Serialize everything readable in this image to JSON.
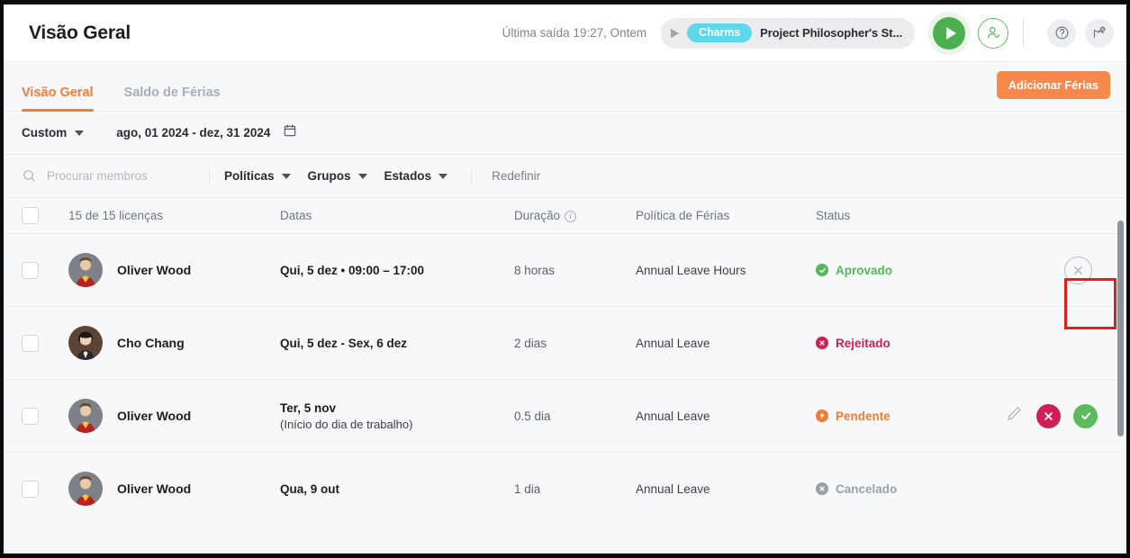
{
  "header": {
    "title": "Visão Geral",
    "last_out": "Última saída 19:27, Ontem",
    "timer_tag": "Charms",
    "timer_project": "Project Philosopher's St...",
    "play_icon": "play-icon",
    "user_icon": "user-check-icon",
    "help_icon": "question-mark-icon",
    "settings_icon": "settings-gear-icon"
  },
  "tabs": {
    "items": [
      {
        "label": "Visão Geral",
        "active": true
      },
      {
        "label": "Saldo de Férias",
        "active": false
      }
    ],
    "add_button": "Adicionar Férias"
  },
  "daterange": {
    "preset": "Custom",
    "range": "ago, 01 2024 - dez, 31 2024",
    "calendar_icon": "calendar-icon"
  },
  "filters": {
    "search_placeholder": "Procurar membros",
    "search_value": "",
    "search_icon": "search-icon",
    "dropdowns": [
      "Políticas",
      "Grupos",
      "Estados"
    ],
    "reset": "Redefinir"
  },
  "table": {
    "headers": {
      "licenses": "15 de 15 licenças",
      "dates": "Datas",
      "duration": "Duração",
      "duration_info_icon": "info-icon",
      "policy": "Política de Férias",
      "status": "Status"
    },
    "rows": [
      {
        "name": "Oliver Wood",
        "avatar": "oliver-wood-avatar",
        "dates": "Qui, 5 dez • 09:00 – 17:00",
        "dates_sub": "",
        "duration": "8 horas",
        "policy": "Annual Leave Hours",
        "status": "Aprovado",
        "status_kind": "approved",
        "actions": [
          "cancel-circle"
        ]
      },
      {
        "name": "Cho Chang",
        "avatar": "cho-chang-avatar",
        "dates": "Qui, 5 dez - Sex, 6 dez",
        "dates_sub": "",
        "duration": "2 dias",
        "policy": "Annual Leave",
        "status": "Rejeitado",
        "status_kind": "rejected",
        "actions": []
      },
      {
        "name": "Oliver Wood",
        "avatar": "oliver-wood-avatar",
        "dates": "Ter, 5 nov",
        "dates_sub": "(Início do dia de trabalho)",
        "duration": "0.5 dia",
        "policy": "Annual Leave",
        "status": "Pendente",
        "status_kind": "pending",
        "actions": [
          "edit",
          "reject",
          "approve"
        ]
      },
      {
        "name": "Oliver Wood",
        "avatar": "oliver-wood-avatar",
        "dates": "Qua, 9 out",
        "dates_sub": "",
        "duration": "1 dia",
        "policy": "Annual Leave",
        "status": "Cancelado",
        "status_kind": "cancel",
        "actions": []
      }
    ]
  },
  "colors": {
    "accent": "#f47b35",
    "approved": "#56b65a",
    "rejected": "#cf1f54",
    "pending": "#f47b35",
    "cancelled": "#9aa0a9",
    "highlight_box": "#e81b17",
    "tag": "#5fd7ea"
  }
}
